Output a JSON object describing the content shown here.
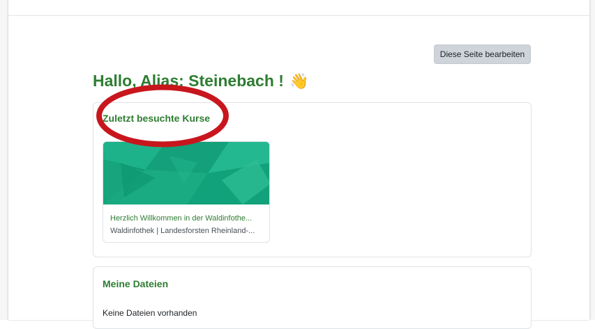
{
  "header": {
    "edit_button_label": "Diese Seite bearbeiten"
  },
  "greeting": {
    "text": "Hallo, Alias: Steinebach !",
    "emoji": "👋"
  },
  "recent_courses": {
    "title": "Zuletzt besuchte Kurse",
    "courses": [
      {
        "name": "Herzlich Willkommen in der Waldinfothe...",
        "category": "Waldinfothek | Landesforsten Rheinland-..."
      }
    ]
  },
  "my_files": {
    "title": "Meine Dateien",
    "empty_message": "Keine Dateien vorhanden"
  },
  "colors": {
    "accent_green": "#2e7d32",
    "course_image_green": "#16a77f",
    "annotation_red": "#c8161d",
    "button_gray": "#ced4da"
  }
}
